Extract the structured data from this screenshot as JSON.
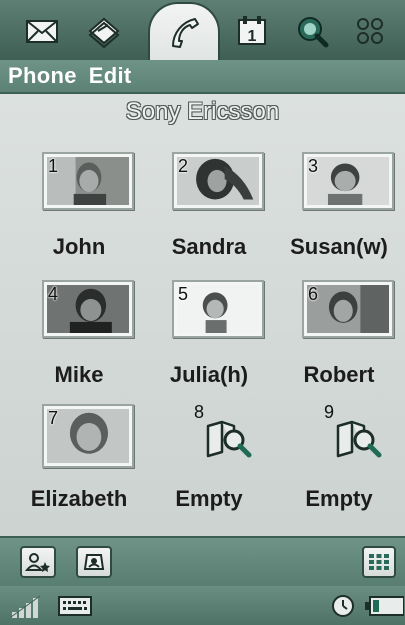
{
  "app_tabs": [
    {
      "icon": "envelope-icon",
      "active": false
    },
    {
      "icon": "contacts-book-icon",
      "active": false
    },
    {
      "icon": "phone-handset-icon",
      "active": true
    },
    {
      "icon": "calendar-icon",
      "active": false
    },
    {
      "icon": "search-web-icon",
      "active": false
    },
    {
      "icon": "apps-grid-icon",
      "active": false
    }
  ],
  "menu": {
    "phone_label": "Phone",
    "edit_label": "Edit"
  },
  "operator": "Sony Ericsson",
  "speed_dial": [
    {
      "number": "1",
      "name": "John",
      "empty": false
    },
    {
      "number": "2",
      "name": "Sandra",
      "empty": false
    },
    {
      "number": "3",
      "name": "Susan(w)",
      "empty": false
    },
    {
      "number": "4",
      "name": "Mike",
      "empty": false
    },
    {
      "number": "5",
      "name": "Julia(h)",
      "empty": false
    },
    {
      "number": "6",
      "name": "Robert",
      "empty": false
    },
    {
      "number": "7",
      "name": "Elizabeth",
      "empty": false
    },
    {
      "number": "8",
      "name": "Empty",
      "empty": true
    },
    {
      "number": "9",
      "name": "Empty",
      "empty": true
    }
  ],
  "toolbar": {
    "left_buttons": [
      "contact-favorite-icon",
      "contact-card-icon"
    ],
    "right_button": "dialpad-icon"
  },
  "status": {
    "icons": [
      "signal-strength-icon",
      "keyboard-icon",
      "clock-icon",
      "battery-icon"
    ]
  },
  "colors": {
    "chrome_green": "#5c8175",
    "menu_text": "#ffffff",
    "background": "#d4dad7"
  }
}
